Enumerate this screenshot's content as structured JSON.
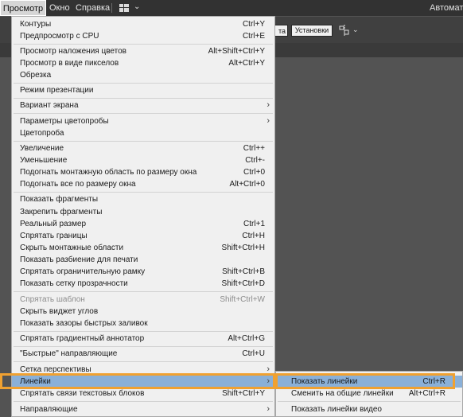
{
  "menubar": {
    "items": [
      {
        "label": "Просмотр"
      },
      {
        "label": "Окно"
      },
      {
        "label": "Справка"
      }
    ],
    "workspace_icon": "workspace-grid-icon",
    "workspace_chevron": "⌄",
    "right_label": "Автомати"
  },
  "control_bar": {
    "partial_button": "та",
    "setup_button": "Установки",
    "align_icon": "align-objects-icon",
    "align_chevron": "⌄"
  },
  "view_menu": {
    "items": [
      {
        "label": "Контуры",
        "shortcut": "Ctrl+Y"
      },
      {
        "label": "Предпросмотр с CPU",
        "shortcut": "Ctrl+E"
      },
      {
        "label": "Просмотр наложения цветов",
        "shortcut": "Alt+Shift+Ctrl+Y"
      },
      {
        "label": "Просмотр в виде пикселов",
        "shortcut": "Alt+Ctrl+Y"
      },
      {
        "label": "Обрезка",
        "shortcut": ""
      },
      {
        "label": "Режим презентации",
        "shortcut": ""
      },
      {
        "label": "Вариант экрана",
        "shortcut": "",
        "arrow": "›"
      },
      {
        "label": "Параметры цветопробы",
        "shortcut": "",
        "arrow": "›"
      },
      {
        "label": "Цветопроба",
        "shortcut": ""
      },
      {
        "label": "Увеличение",
        "shortcut": "Ctrl++"
      },
      {
        "label": "Уменьшение",
        "shortcut": "Ctrl+-"
      },
      {
        "label": "Подогнать монтажную область по размеру окна",
        "shortcut": "Ctrl+0"
      },
      {
        "label": "Подогнать все по размеру окна",
        "shortcut": "Alt+Ctrl+0"
      },
      {
        "label": "Показать фрагменты",
        "shortcut": ""
      },
      {
        "label": "Закрепить фрагменты",
        "shortcut": ""
      },
      {
        "label": "Реальный размер",
        "shortcut": "Ctrl+1"
      },
      {
        "label": "Спрятать границы",
        "shortcut": "Ctrl+H"
      },
      {
        "label": "Скрыть монтажные области",
        "shortcut": "Shift+Ctrl+H"
      },
      {
        "label": "Показать разбиение для печати",
        "shortcut": ""
      },
      {
        "label": "Спрятать ограничительную рамку",
        "shortcut": "Shift+Ctrl+B"
      },
      {
        "label": "Показать сетку прозрачности",
        "shortcut": "Shift+Ctrl+D"
      },
      {
        "label": "Спрятать шаблон",
        "shortcut": "Shift+Ctrl+W",
        "disabled": true
      },
      {
        "label": "Скрыть виджет углов",
        "shortcut": ""
      },
      {
        "label": "Показать зазоры быстрых заливок",
        "shortcut": ""
      },
      {
        "label": "Спрятать градиентный аннотатор",
        "shortcut": "Alt+Ctrl+G"
      },
      {
        "label": "\"Быстрые\" направляющие",
        "shortcut": "Ctrl+U"
      },
      {
        "label": "Сетка перспективы",
        "shortcut": "",
        "arrow": "›"
      },
      {
        "label": "Линейки",
        "shortcut": "",
        "arrow": "›",
        "highlighted": true
      },
      {
        "label": "Спрятать связи текстовых блоков",
        "shortcut": "Shift+Ctrl+Y"
      },
      {
        "label": "Направляющие",
        "shortcut": "",
        "arrow": "›"
      }
    ]
  },
  "rulers_submenu": {
    "items": [
      {
        "label": "Показать линейки",
        "shortcut": "Ctrl+R",
        "highlighted": true
      },
      {
        "label": "Сменить на общие линейки",
        "shortcut": "Alt+Ctrl+R"
      },
      {
        "label": "Показать линейки видео",
        "shortcut": ""
      }
    ]
  },
  "colors": {
    "menubar_bg": "#323232",
    "menu_bg": "#f0f0f0",
    "highlight_bg": "#8ab0d8",
    "focus_outline": "#f0a131",
    "workspace_bg": "#535353"
  }
}
